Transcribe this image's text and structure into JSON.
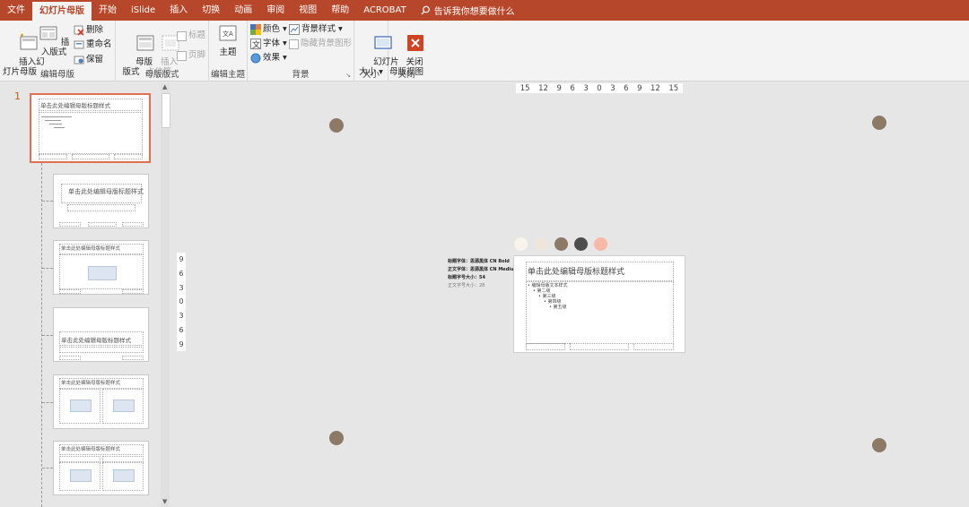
{
  "tabs": [
    "文件",
    "幻灯片母版",
    "开始",
    "iSlide",
    "插入",
    "切换",
    "动画",
    "审阅",
    "视图",
    "帮助",
    "ACROBAT"
  ],
  "active_tab_index": 1,
  "tell_me": "告诉我你想要做什么",
  "ribbon": {
    "edit_master": {
      "label": "编辑母版",
      "insert_slide_master": "插入幻\n灯片母版",
      "insert_layout": "插入版式",
      "delete": "删除",
      "rename": "重命名",
      "preserve": "保留"
    },
    "master_layout": {
      "label": "母版版式",
      "master_layout_btn": "母版\n版式",
      "insert_placeholder": "插入\n占位符",
      "title": "标题",
      "footer": "页脚"
    },
    "edit_theme": {
      "label": "编辑主题",
      "themes": "主题"
    },
    "background": {
      "label": "背景",
      "colors": "颜色",
      "fonts": "字体",
      "effects": "效果",
      "bg_styles": "背景样式",
      "hide_bg": "隐藏背景图形"
    },
    "size": {
      "label": "大小",
      "slide_size": "幻灯片\n大小"
    },
    "close": {
      "label": "关闭",
      "close_master": "关闭\n母版视图"
    }
  },
  "left_panel": {
    "slide_number": "1",
    "thumb_title": "单击此处编辑母版标题样式"
  },
  "canvas": {
    "ruler_h": [
      "15",
      "12",
      "9",
      "6",
      "3",
      "0",
      "3",
      "6",
      "9",
      "12",
      "15"
    ],
    "ruler_v": [
      "9",
      "6",
      "3",
      "0",
      "3",
      "6",
      "9"
    ],
    "dot_color": "#8c7a67",
    "swatches": [
      "#f8f3ec",
      "#efe6db",
      "#8c7a67",
      "#4d4d4d",
      "#f7b9a5"
    ],
    "info_lines": [
      "标题字体：思源黑体 CN Bold",
      "正文字体：思源黑体 CN Medium",
      "标题字号大小：54",
      "正文字号大小：28"
    ],
    "slide_title": "单击此处编辑母版标题样式",
    "slide_body": [
      "• 编辑母版文本样式",
      "• 第二级",
      "• 第三级",
      "• 第四级",
      "• 第五级"
    ]
  }
}
